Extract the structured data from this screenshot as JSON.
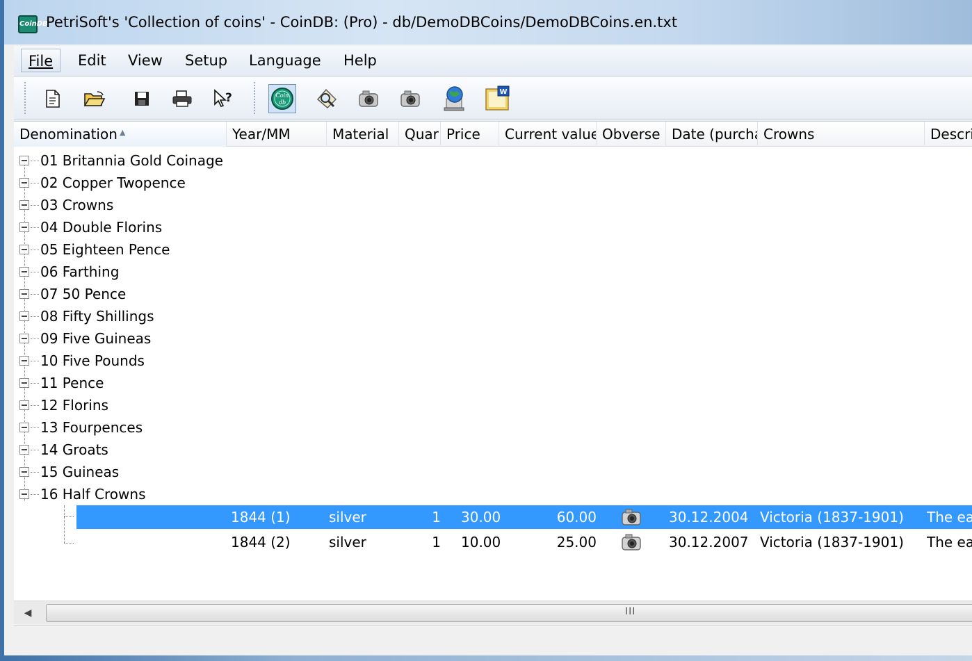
{
  "window": {
    "title": "PetriSoft's 'Collection of coins' - CoinDB:  (Pro) - db/DemoDBCoins/DemoDBCoins.en.txt",
    "icon_label": "CoinDB"
  },
  "menu": [
    {
      "label": "File",
      "underline": "F"
    },
    {
      "label": "Edit",
      "underline": "E"
    },
    {
      "label": "View",
      "underline": "V"
    },
    {
      "label": "Setup",
      "underline": "S"
    },
    {
      "label": "Language",
      "underline": "L"
    },
    {
      "label": "Help",
      "underline": "H"
    }
  ],
  "toolbar": {
    "buttons": [
      {
        "icon": "new-document-icon"
      },
      {
        "icon": "open-folder-icon"
      },
      {
        "icon": "save-icon"
      },
      {
        "icon": "print-icon"
      },
      {
        "icon": "context-help-icon"
      },
      {
        "icon": "coin-db-icon",
        "pressed": true,
        "label": "Coin db"
      },
      {
        "icon": "magnifier-icon"
      },
      {
        "icon": "camera-icon"
      },
      {
        "icon": "camera-icon"
      },
      {
        "icon": "globe-computer-icon"
      },
      {
        "icon": "word-export-icon",
        "label": "W"
      }
    ]
  },
  "columns": [
    {
      "label": "Denomination",
      "sorted": true
    },
    {
      "label": "Year/MM"
    },
    {
      "label": "Material"
    },
    {
      "label": "Quar"
    },
    {
      "label": "Price"
    },
    {
      "label": "Current value"
    },
    {
      "label": "Obverse"
    },
    {
      "label": "Date (purcha"
    },
    {
      "label": "Crowns"
    },
    {
      "label": "Descrip"
    }
  ],
  "tree": [
    "01 Britannia Gold Coinage",
    "02 Copper Twopence",
    "03 Crowns",
    "04 Double Florins",
    "05 Eighteen Pence",
    "06 Farthing",
    "07 50 Pence",
    "08 Fifty Shillings",
    "09 Five Guineas",
    "10 Five Pounds",
    "11 Pence",
    "12 Florins",
    "13 Fourpences",
    "14 Groats",
    "15 Guineas",
    "16 Half Crowns"
  ],
  "rows": [
    {
      "year": "1844 (1)",
      "material": "silver",
      "quantity": "1",
      "price": "30.00",
      "current_value": "60.00",
      "obverse_icon": "camera-icon",
      "date": "30.12.2004",
      "crowns": "Victoria (1837-1901)",
      "description": "The ear",
      "selected": true
    },
    {
      "year": "1844 (2)",
      "material": "silver",
      "quantity": "1",
      "price": "10.00",
      "current_value": "25.00",
      "obverse_icon": "camera-icon",
      "date": "30.12.2007",
      "crowns": "Victoria (1837-1901)",
      "description": "The ear",
      "selected": false
    }
  ],
  "scrollbar": {
    "grip": "III"
  },
  "status": {
    "text": ""
  }
}
